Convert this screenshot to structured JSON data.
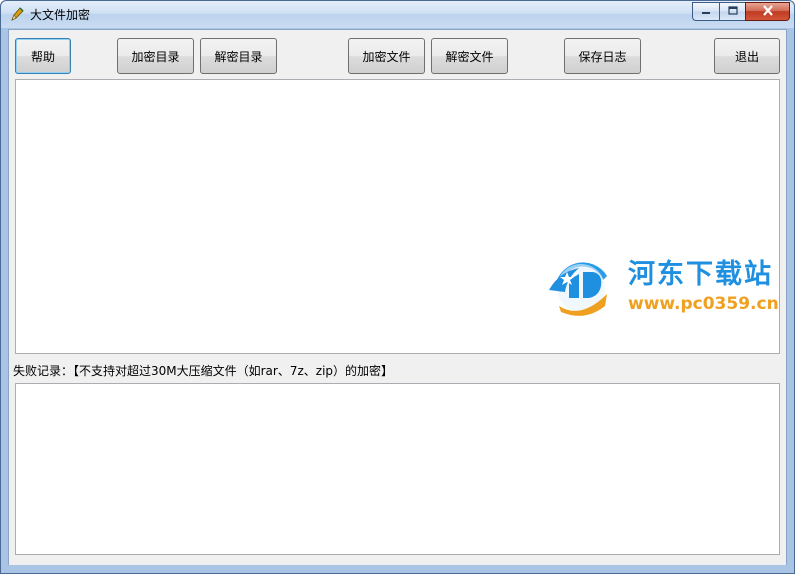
{
  "window": {
    "title": "大文件加密",
    "icon": "app-pen-icon"
  },
  "toolbar": {
    "help": "帮助",
    "encrypt_dir": "加密目录",
    "decrypt_dir": "解密目录",
    "encrypt_file": "加密文件",
    "decrypt_file": "解密文件",
    "save_log": "保存日志",
    "exit": "退出"
  },
  "log": {
    "content": ""
  },
  "failures": {
    "label": "失败记录：【不支持对超过30M大压缩文件（如rar、7z、zip）的加密】",
    "content": ""
  },
  "watermark": {
    "name": "河东下载站",
    "url": "www.pc0359.cn"
  },
  "colors": {
    "watermark_blue": "#1f8fe0",
    "watermark_orange": "#f0a020",
    "close_red": "#c8452c"
  }
}
